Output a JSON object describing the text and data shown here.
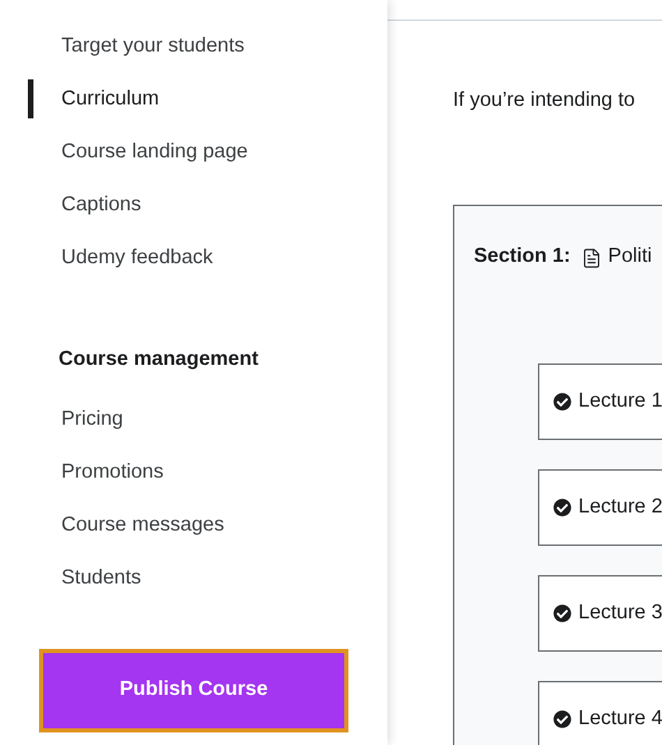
{
  "sidebar": {
    "groups": [
      {
        "items": [
          {
            "label": "Target your students",
            "selected": false
          },
          {
            "label": "Curriculum",
            "selected": true
          },
          {
            "label": "Course landing page",
            "selected": false
          },
          {
            "label": "Captions",
            "selected": false
          },
          {
            "label": "Udemy feedback",
            "selected": false
          }
        ]
      },
      {
        "heading": "Course management",
        "items": [
          {
            "label": "Pricing",
            "selected": false
          },
          {
            "label": "Promotions",
            "selected": false
          },
          {
            "label": "Course messages",
            "selected": false
          },
          {
            "label": "Students",
            "selected": false
          }
        ]
      }
    ],
    "publish_button": "Publish Course"
  },
  "main": {
    "intro": "If you’re intending to",
    "section": {
      "label": "Section 1:",
      "title": "Politi",
      "lectures": [
        {
          "label": "Lecture 1",
          "done": true
        },
        {
          "label": "Lecture 2",
          "done": true
        },
        {
          "label": "Lecture 3",
          "done": true
        },
        {
          "label": "Lecture 4",
          "done": true
        }
      ]
    }
  }
}
